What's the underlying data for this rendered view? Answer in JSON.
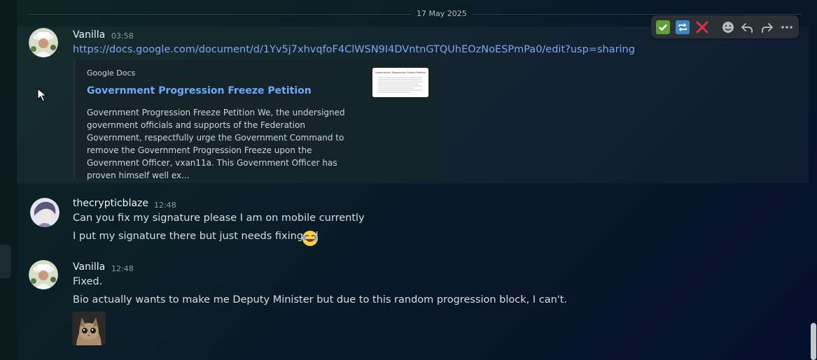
{
  "date_divider": "17 May 2025",
  "messages": [
    {
      "author": "Vanilla",
      "time": "03:58",
      "link": "https://docs.google.com/document/d/1Yv5j7xhvqfoF4ClWSN9I4DVntnGTQUhEOzNoESPmPa0/edit?usp=sharing",
      "embed": {
        "provider": "Google Docs",
        "title": "Government Progression Freeze Petition",
        "description": "Government Progression Freeze Petition We, the undersigned government officials and supports of the Federation Government, respectfully urge the Government Command to remove the Government Progression Freeze upon the Government Officer, vxan11a. This Government Officer has proven himself well ex...",
        "thumbnail_caption": "Government Progression Freeze Petition"
      }
    },
    {
      "author": "thecrypticblaze",
      "time": "12:48",
      "lines": [
        "Can you fix my signature please I am on mobile currently",
        "I put my signature there but just needs fixing lol"
      ],
      "emoji": "joy-emoji"
    },
    {
      "author": "Vanilla",
      "time": "12:48",
      "lines": [
        "Fixed.",
        "Bio actually wants to make me Deputy Minister but due to this random progression block, I can't."
      ],
      "sticker": "crying-cat-sticker"
    }
  ],
  "toolbar": {
    "actions": [
      "check-react-icon",
      "repeat-react-icon",
      "cross-react-icon",
      "add-reaction-icon",
      "reply-icon",
      "forward-icon",
      "more-icon"
    ]
  },
  "colors": {
    "link": "#7ea6f2",
    "embed_title": "#6ea8ff",
    "check": "#5fa134",
    "repeat": "#3b88c3",
    "cross": "#dd2e44"
  }
}
